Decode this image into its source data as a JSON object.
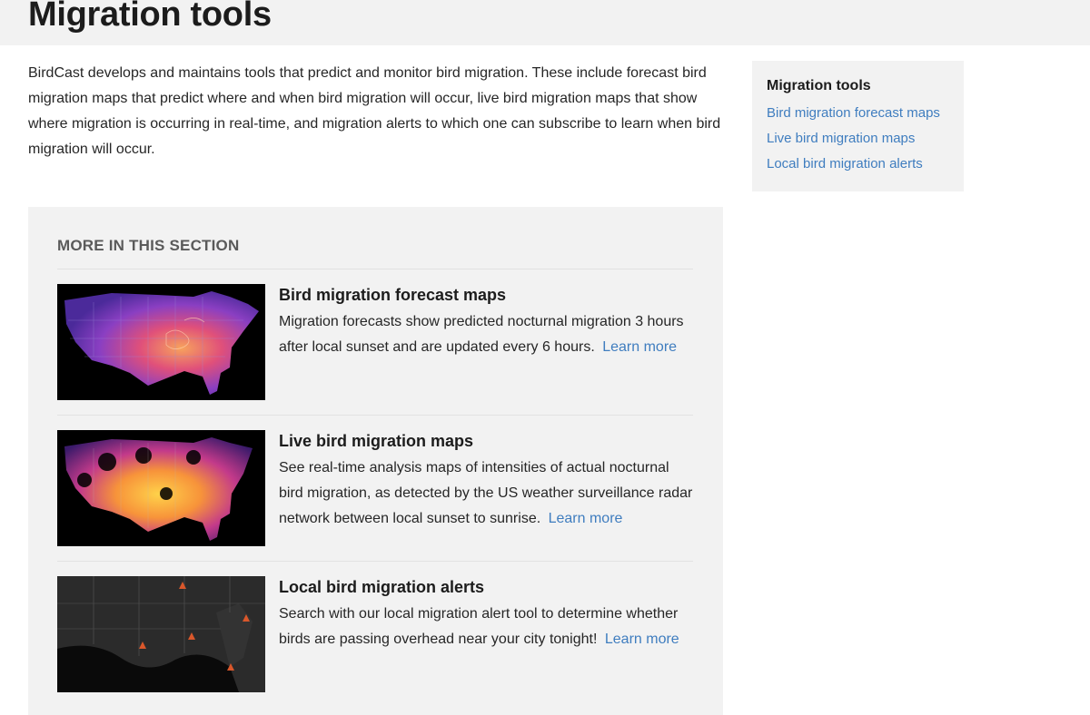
{
  "page": {
    "title": "Migration tools",
    "intro": "BirdCast develops and maintains tools that predict and monitor bird migration. These include forecast bird migration maps that predict where and when bird migration will occur, live bird migration maps that show where migration is occurring in real-time, and migration alerts to which one can subscribe to learn when bird migration will occur."
  },
  "sidebar": {
    "title": "Migration tools",
    "links": [
      "Bird migration forecast maps",
      "Live bird migration maps",
      "Local bird migration alerts"
    ]
  },
  "section": {
    "heading": "MORE IN THIS SECTION",
    "cards": [
      {
        "title": "Bird migration forecast maps",
        "description": "Migration forecasts show predicted nocturnal migration 3 hours after local sunset and are updated every 6 hours.",
        "link": "Learn more",
        "thumb_icon": "forecast-map-thumbnail"
      },
      {
        "title": "Live bird migration maps",
        "description": "See real-time analysis maps of intensities of actual nocturnal bird migration, as detected by the US weather surveillance radar network between local sunset to sunrise.",
        "link": "Learn more",
        "thumb_icon": "live-map-thumbnail"
      },
      {
        "title": "Local bird migration alerts",
        "description": "Search with our local migration alert tool to determine whether birds are passing overhead near your city tonight!",
        "link": "Learn more",
        "thumb_icon": "alerts-map-thumbnail"
      }
    ]
  },
  "colors": {
    "link": "#3f7dbf",
    "panel_bg": "#f2f2f2",
    "heading_gray": "#5a5a5a"
  }
}
